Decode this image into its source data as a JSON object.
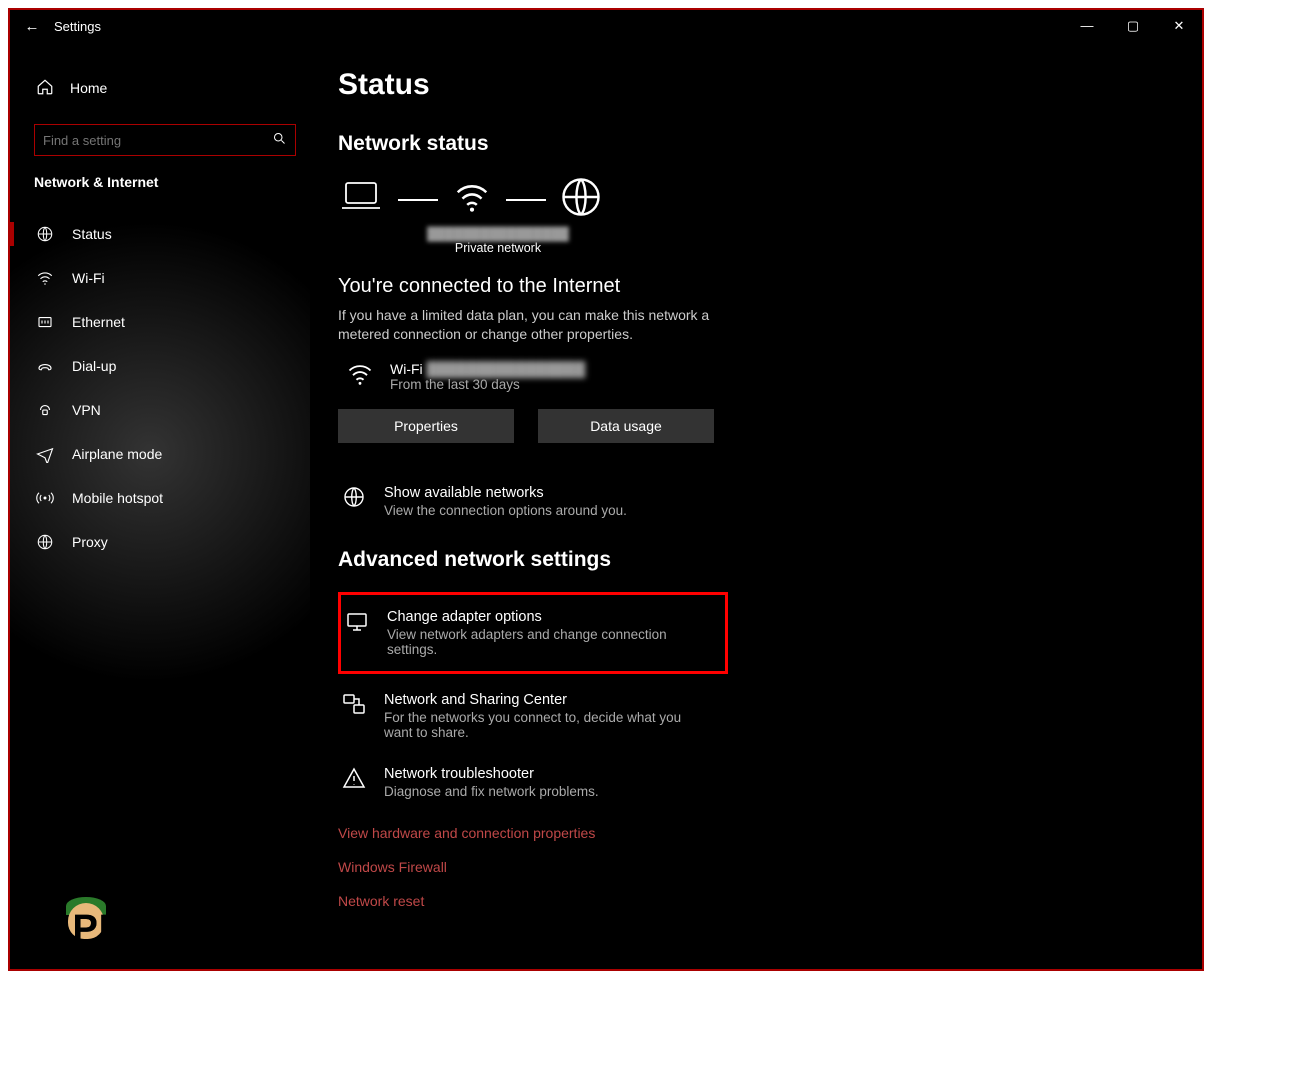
{
  "window": {
    "title": "Settings"
  },
  "sidebar": {
    "home": "Home",
    "search_placeholder": "Find a setting",
    "category": "Network & Internet",
    "items": [
      {
        "label": "Status",
        "active": true
      },
      {
        "label": "Wi-Fi",
        "active": false
      },
      {
        "label": "Ethernet",
        "active": false
      },
      {
        "label": "Dial-up",
        "active": false
      },
      {
        "label": "VPN",
        "active": false
      },
      {
        "label": "Airplane mode",
        "active": false
      },
      {
        "label": "Mobile hotspot",
        "active": false
      },
      {
        "label": "Proxy",
        "active": false
      }
    ]
  },
  "status": {
    "page_title": "Status",
    "section_title": "Network status",
    "diagram_caption_blurred": "████████████████",
    "diagram_caption": "Private network",
    "connected_title": "You're connected to the Internet",
    "connected_desc": "If you have a limited data plan, you can make this network a metered connection or change other properties.",
    "conn_name_prefix": "Wi-Fi",
    "conn_name_blurred": "████████████████",
    "conn_sub": "From the last 30 days",
    "btn_properties": "Properties",
    "btn_data_usage": "Data usage",
    "show_networks_title": "Show available networks",
    "show_networks_sub": "View the connection options around you.",
    "adv_title": "Advanced network settings",
    "change_adapter_title": "Change adapter options",
    "change_adapter_sub": "View network adapters and change connection settings.",
    "sharing_title": "Network and Sharing Center",
    "sharing_sub": "For the networks you connect to, decide what you want to share.",
    "troubleshoot_title": "Network troubleshooter",
    "troubleshoot_sub": "Diagnose and fix network problems.",
    "link_hardware": "View hardware and connection properties",
    "link_firewall": "Windows Firewall",
    "link_reset": "Network reset"
  },
  "watermark": "APPUALS"
}
